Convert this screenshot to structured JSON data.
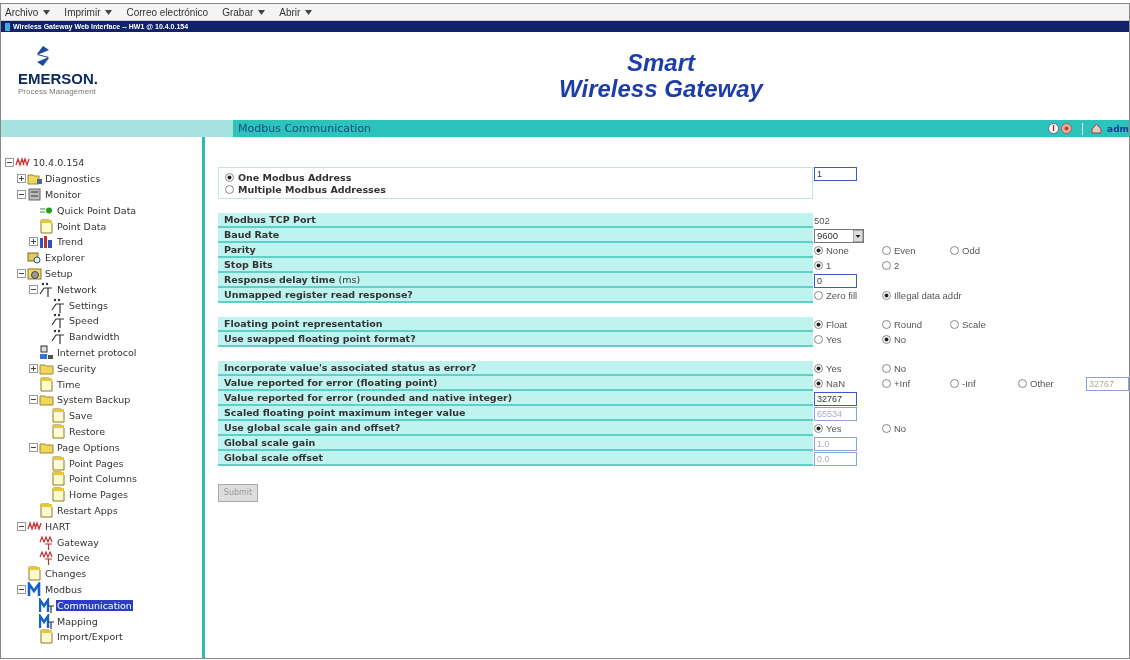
{
  "menu_bar": [
    {
      "label": "Archivo",
      "dropdown": true
    },
    {
      "label": "Imprimir",
      "dropdown": true
    },
    {
      "label": "Correo electrónico",
      "dropdown": false
    },
    {
      "label": "Grabar",
      "dropdown": true
    },
    {
      "label": "Abrir",
      "dropdown": true
    }
  ],
  "window": {
    "title": "Wireless Gateway Web Interface -- HW1 @ 10.4.0.154"
  },
  "header": {
    "logo": {
      "name": "EMERSON.",
      "subtitle": "Process Management"
    },
    "title_lines": [
      "Smart",
      "Wireless Gateway"
    ]
  },
  "page_bar": {
    "title": "Modbus Communication",
    "user": "adm"
  },
  "tree": {
    "label": "10.4.0.154",
    "kind": "hart",
    "selected": false,
    "expanded": true,
    "children": [
      {
        "label": "Diagnostics",
        "kind": "folder-tool",
        "selected": false,
        "expanded": false
      },
      {
        "label": "Monitor",
        "kind": "monitor",
        "selected": false,
        "expanded": true,
        "children": [
          {
            "label": "Quick Point Data",
            "kind": "dot",
            "selected": false
          },
          {
            "label": "Point Data",
            "kind": "page",
            "selected": false
          },
          {
            "label": "Trend",
            "kind": "chart",
            "selected": false,
            "expanded": false
          }
        ]
      },
      {
        "label": "Explorer",
        "kind": "explorer",
        "selected": false
      },
      {
        "label": "Setup",
        "kind": "gear",
        "selected": false,
        "expanded": true,
        "children": [
          {
            "label": "Network",
            "kind": "network",
            "selected": false,
            "expanded": true,
            "children": [
              {
                "label": "Settings",
                "kind": "network",
                "selected": false
              },
              {
                "label": "Speed",
                "kind": "network",
                "selected": false
              },
              {
                "label": "Bandwidth",
                "kind": "network",
                "selected": false
              }
            ]
          },
          {
            "label": "Internet protocol",
            "kind": "computer",
            "selected": false
          },
          {
            "label": "Security",
            "kind": "folder",
            "selected": false,
            "expanded": false
          },
          {
            "label": "Time",
            "kind": "page",
            "selected": false
          },
          {
            "label": "System Backup",
            "kind": "folder",
            "selected": false,
            "expanded": true,
            "children": [
              {
                "label": "Save",
                "kind": "page",
                "selected": false
              },
              {
                "label": "Restore",
                "kind": "page",
                "selected": false
              }
            ]
          },
          {
            "label": "Page Options",
            "kind": "folder",
            "selected": false,
            "expanded": true,
            "children": [
              {
                "label": "Point Pages",
                "kind": "page",
                "selected": false
              },
              {
                "label": "Point Columns",
                "kind": "page",
                "selected": false
              },
              {
                "label": "Home Pages",
                "kind": "page",
                "selected": false
              }
            ]
          },
          {
            "label": "Restart Apps",
            "kind": "page",
            "selected": false
          }
        ]
      },
      {
        "label": "HART",
        "kind": "hart",
        "selected": false,
        "expanded": true,
        "children": [
          {
            "label": "Gateway",
            "kind": "hart-t",
            "selected": false
          },
          {
            "label": "Device",
            "kind": "hart-t",
            "selected": false
          }
        ]
      },
      {
        "label": "Changes",
        "kind": "page",
        "selected": false
      },
      {
        "label": "Modbus",
        "kind": "modbus",
        "selected": false,
        "expanded": true,
        "children": [
          {
            "label": "Communication",
            "kind": "modbus-t",
            "selected": true
          },
          {
            "label": "Mapping",
            "kind": "modbus-t",
            "selected": false
          },
          {
            "label": "Import/Export",
            "kind": "page",
            "selected": false
          }
        ]
      }
    ]
  },
  "form": {
    "address_mode": {
      "options": [
        {
          "label": "One Modbus Address",
          "selected": true
        },
        {
          "label": "Multiple Modbus Addresses",
          "selected": false
        }
      ],
      "value": "1"
    },
    "groups": [
      {
        "rows": [
          {
            "label": "Modbus TCP Port",
            "kind": "text",
            "value": "502"
          },
          {
            "label": "Baud Rate",
            "kind": "select",
            "value": "9600"
          },
          {
            "label": "Parity",
            "kind": "radios",
            "options": [
              {
                "label": "None",
                "selected": true
              },
              {
                "label": "Even",
                "selected": false
              },
              {
                "label": "Odd",
                "selected": false
              }
            ]
          },
          {
            "label": "Stop Bits",
            "kind": "radios",
            "options": [
              {
                "label": "1",
                "selected": true
              },
              {
                "label": "2",
                "selected": false
              }
            ]
          },
          {
            "label": "Response delay time",
            "unit": "(ms)",
            "kind": "input",
            "value": "0",
            "disabled": false
          },
          {
            "label": "Unmapped register read response?",
            "kind": "radios",
            "options": [
              {
                "label": "Zero fill",
                "selected": false
              },
              {
                "label": "Illegal data addr",
                "selected": true
              }
            ]
          }
        ]
      },
      {
        "rows": [
          {
            "label": "Floating point representation",
            "kind": "radios",
            "options": [
              {
                "label": "Float",
                "selected": true
              },
              {
                "label": "Round",
                "selected": false
              },
              {
                "label": "Scale",
                "selected": false
              }
            ]
          },
          {
            "label": "Use swapped floating point format?",
            "kind": "radios",
            "options": [
              {
                "label": "Yes",
                "selected": false
              },
              {
                "label": "No",
                "selected": true
              }
            ]
          }
        ]
      },
      {
        "rows": [
          {
            "label": "Incorporate value's associated status as error?",
            "kind": "radios",
            "options": [
              {
                "label": "Yes",
                "selected": true
              },
              {
                "label": "No",
                "selected": false
              }
            ]
          },
          {
            "label": "Value reported for error (floating point)",
            "kind": "radios",
            "options": [
              {
                "label": "NaN",
                "selected": true
              },
              {
                "label": "+Inf",
                "selected": false
              },
              {
                "label": "-Inf",
                "selected": false
              },
              {
                "label": "Other",
                "selected": false
              }
            ],
            "input": {
              "value": "32767",
              "disabled": true
            }
          },
          {
            "label": "Value reported for error (rounded and native integer)",
            "kind": "input",
            "value": "32767",
            "disabled": false
          },
          {
            "label": "Scaled floating point maximum integer value",
            "kind": "input",
            "value": "65534",
            "disabled": true
          },
          {
            "label": "Use global scale gain and offset?",
            "kind": "radios",
            "options": [
              {
                "label": "Yes",
                "selected": true
              },
              {
                "label": "No",
                "selected": false
              }
            ]
          },
          {
            "label": "Global scale gain",
            "kind": "input",
            "value": "1.0",
            "disabled": true
          },
          {
            "label": "Global scale offset",
            "kind": "input",
            "value": "0.0",
            "disabled": true
          }
        ]
      }
    ],
    "submit": {
      "label": "Submit",
      "disabled": true
    }
  }
}
